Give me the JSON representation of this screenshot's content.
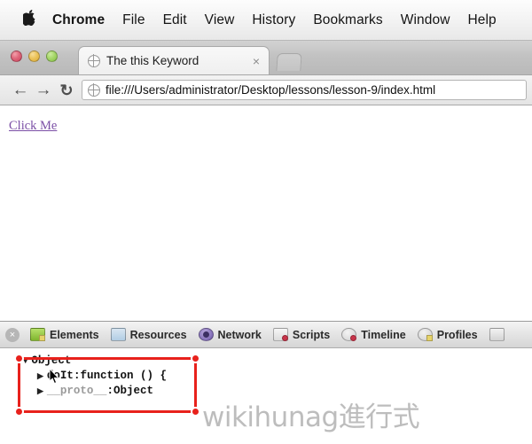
{
  "menubar": {
    "apple_glyph": "",
    "items": [
      {
        "label": "Chrome",
        "bold": true
      },
      {
        "label": "File",
        "bold": false
      },
      {
        "label": "Edit",
        "bold": false
      },
      {
        "label": "View",
        "bold": false
      },
      {
        "label": "History",
        "bold": false
      },
      {
        "label": "Bookmarks",
        "bold": false
      },
      {
        "label": "Window",
        "bold": false
      },
      {
        "label": "Help",
        "bold": false
      }
    ]
  },
  "window": {
    "traffic_lights": [
      "close-red",
      "minimize-yellow",
      "zoom-green"
    ]
  },
  "tab": {
    "title": "The this Keyword",
    "favicon": "globe-icon",
    "close_label": "×",
    "new_tab_label": ""
  },
  "navbar": {
    "back_glyph": "←",
    "forward_glyph": "→",
    "reload_glyph": "↻",
    "url": "file:///Users/administrator/Desktop/lessons/lesson-9/index.html",
    "site_icon": "globe-icon"
  },
  "page": {
    "link_text": "Click Me",
    "link_color": "#7b4fa6"
  },
  "devtools": {
    "close_label": "×",
    "tabs": [
      {
        "label": "Elements",
        "icon": "elements-icon"
      },
      {
        "label": "Resources",
        "icon": "resources-icon"
      },
      {
        "label": "Network",
        "icon": "network-icon"
      },
      {
        "label": "Scripts",
        "icon": "scripts-icon"
      },
      {
        "label": "Timeline",
        "icon": "timeline-icon"
      },
      {
        "label": "Profiles",
        "icon": "profiles-icon"
      },
      {
        "label": "",
        "icon": "audits-icon"
      }
    ],
    "console": {
      "root": {
        "triangle": "▼",
        "label": "Object"
      },
      "properties": [
        {
          "triangle": "▶",
          "name": "doIt",
          "separator": ": ",
          "value": "function () {"
        },
        {
          "triangle": "▶",
          "name": "__proto__",
          "separator": ": ",
          "value": "Object"
        }
      ]
    }
  },
  "annotation": {
    "shape": "rectangle",
    "color": "#e8211c",
    "handles": [
      "top-left",
      "top-right",
      "bottom-left",
      "bottom-right"
    ]
  },
  "watermark": {
    "text": "wikihunag進行式",
    "color": "#bdbdbd"
  }
}
